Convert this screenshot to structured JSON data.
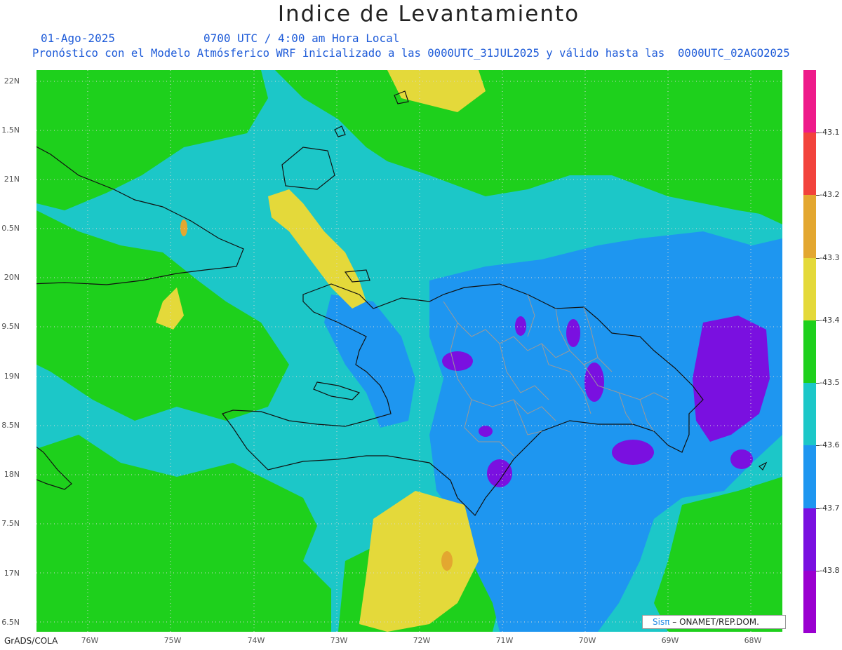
{
  "title": "Indice de Levantamiento",
  "date": "01-Ago-2025",
  "time_line": "0700 UTC / 4:00 am Hora Local",
  "forecast_line": "Pronóstico con el Modelo Atmósferico WRF inicializado a las 0000UTC_31JUL2025 y válido hasta las  0000UTC_02AGO2025",
  "footer_left": "GrADS/COLA",
  "credit": {
    "logo": "Sisπ",
    "text": " – ONAMET/REP.DOM."
  },
  "y_axis_labels": [
    "22N",
    "1.5N",
    "21N",
    "0.5N",
    "20N",
    "9.5N",
    "19N",
    "8.5N",
    "18N",
    "7.5N",
    "17N",
    "6.5N"
  ],
  "x_axis_labels": [
    "76W",
    "75W",
    "74W",
    "73W",
    "72W",
    "71W",
    "70W",
    "69W",
    "68W"
  ],
  "colorbar": {
    "colors": [
      "#ee1a8a",
      "#f2433c",
      "#e3a730",
      "#e4d93a",
      "#1ed01c",
      "#1cc7c8",
      "#1e96f0",
      "#7a10e0",
      "#9a00d0"
    ],
    "labels": [
      "-43.1",
      "-43.2",
      "-43.3",
      "-43.4",
      "-43.5",
      "-43.6",
      "-43.7",
      "-43.8"
    ]
  }
}
